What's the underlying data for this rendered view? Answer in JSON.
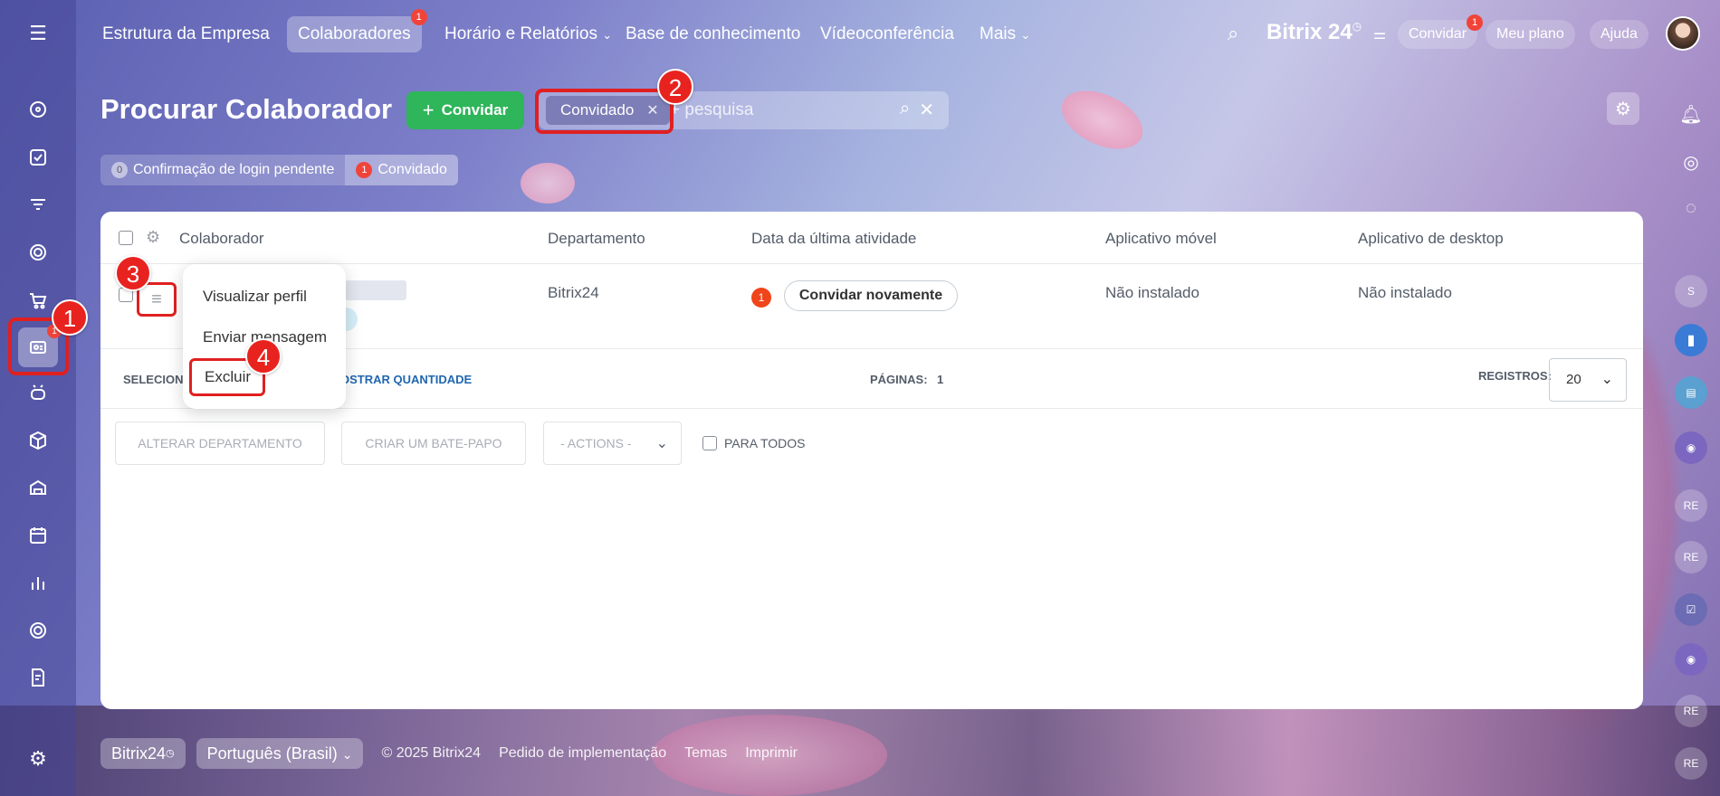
{
  "topnav": {
    "items": [
      {
        "label": "Estrutura da Empresa"
      },
      {
        "label": "Colaboradores",
        "badge": "1"
      },
      {
        "label": "Horário e Relatórios"
      },
      {
        "label": "Base de conhecimento"
      },
      {
        "label": "Vídeoconferência"
      },
      {
        "label": "Mais"
      }
    ],
    "brand": "Bitrix 24",
    "invite_label": "Convidar",
    "invite_badge": "1",
    "plan_label": "Meu plano",
    "help_label": "Ajuda"
  },
  "sidebar": {
    "active_badge": "1"
  },
  "right_rail": {
    "items": [
      "S",
      "RE",
      "RE",
      "RE",
      "RE"
    ]
  },
  "header": {
    "title": "Procurar Colaborador",
    "invite_button": "Convidar",
    "filter_chip": "Convidado",
    "search_placeholder": "+ pesquisa"
  },
  "tabs": [
    {
      "count": "0",
      "label": "Confirmação de login pendente"
    },
    {
      "count": "1",
      "label": "Convidado"
    }
  ],
  "table": {
    "columns": [
      "Colaborador",
      "Departamento",
      "Data da última atividade",
      "Aplicativo móvel",
      "Aplicativo de desktop"
    ],
    "rows": [
      {
        "department": "Bitrix24",
        "activity_badge": "1",
        "reinvite_label": "Convidar novamente",
        "mobile_app": "Não instalado",
        "desktop_app": "Não instalado"
      }
    ]
  },
  "pagination": {
    "selected_prefix": "SELECIONA",
    "show_count": "OSTRAR QUANTIDADE",
    "pages_label": "PÁGINAS:",
    "pages_value": "1",
    "records_label": "REGISTROS:",
    "records_value": "20"
  },
  "actions": {
    "change_dept": "ALTERAR DEPARTAMENTO",
    "create_chat": "CRIAR UM BATE-PAPO",
    "actions_select": "- ACTIONS -",
    "for_all": "PARA TODOS"
  },
  "context_menu": {
    "items": [
      "Visualizar perfil",
      "Enviar mensagem",
      "Excluir"
    ]
  },
  "markers": [
    "1",
    "2",
    "3",
    "4"
  ],
  "footer": {
    "brand": "Bitrix24",
    "language": "Português (Brasil)",
    "copyright": "© 2025 Bitrix24",
    "links": [
      "Pedido de implementação",
      "Temas",
      "Imprimir"
    ]
  },
  "colors": {
    "accent_green": "#2fb55a",
    "badge_red": "#f0443a",
    "annotation_red": "#e02020"
  }
}
